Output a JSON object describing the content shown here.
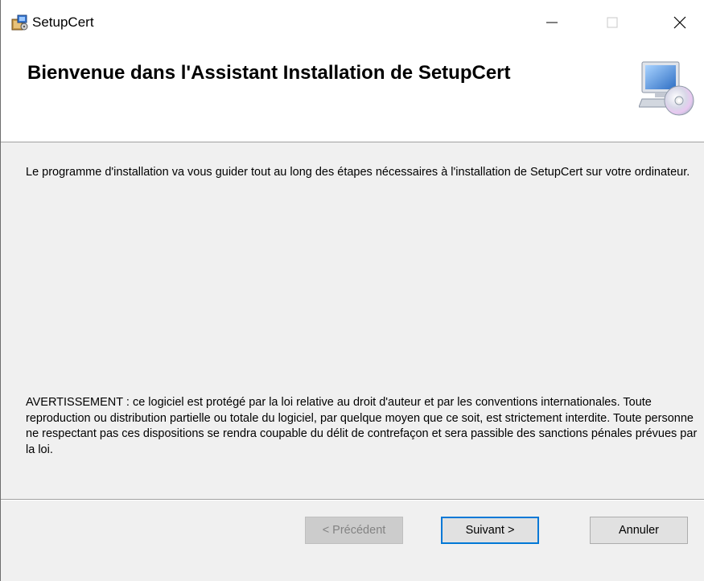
{
  "window": {
    "title": "SetupCert",
    "minimize_glyph": "—",
    "maximize_glyph": "☐",
    "close_glyph": "✕"
  },
  "banner": {
    "title": "Bienvenue dans l'Assistant Installation de SetupCert",
    "icon": "computer-cd-icon"
  },
  "content": {
    "intro": "Le programme d'installation va vous guider tout au long des étapes nécessaires à l'installation de SetupCert sur votre ordinateur.",
    "warning": "AVERTISSEMENT : ce logiciel est protégé par la loi relative au droit d'auteur et par les conventions internationales. Toute reproduction ou distribution partielle ou totale du logiciel, par quelque moyen que ce soit, est strictement interdite. Toute personne ne respectant pas ces dispositions se rendra coupable du délit de contrefaçon et sera passible des sanctions pénales prévues par la loi."
  },
  "buttons": {
    "previous": "< Précédent",
    "next": "Suivant >",
    "cancel": "Annuler",
    "previous_enabled": false
  },
  "colors": {
    "focus_border": "#0078d7",
    "dialog_bg": "#f0f0f0",
    "banner_bg": "#ffffff"
  }
}
